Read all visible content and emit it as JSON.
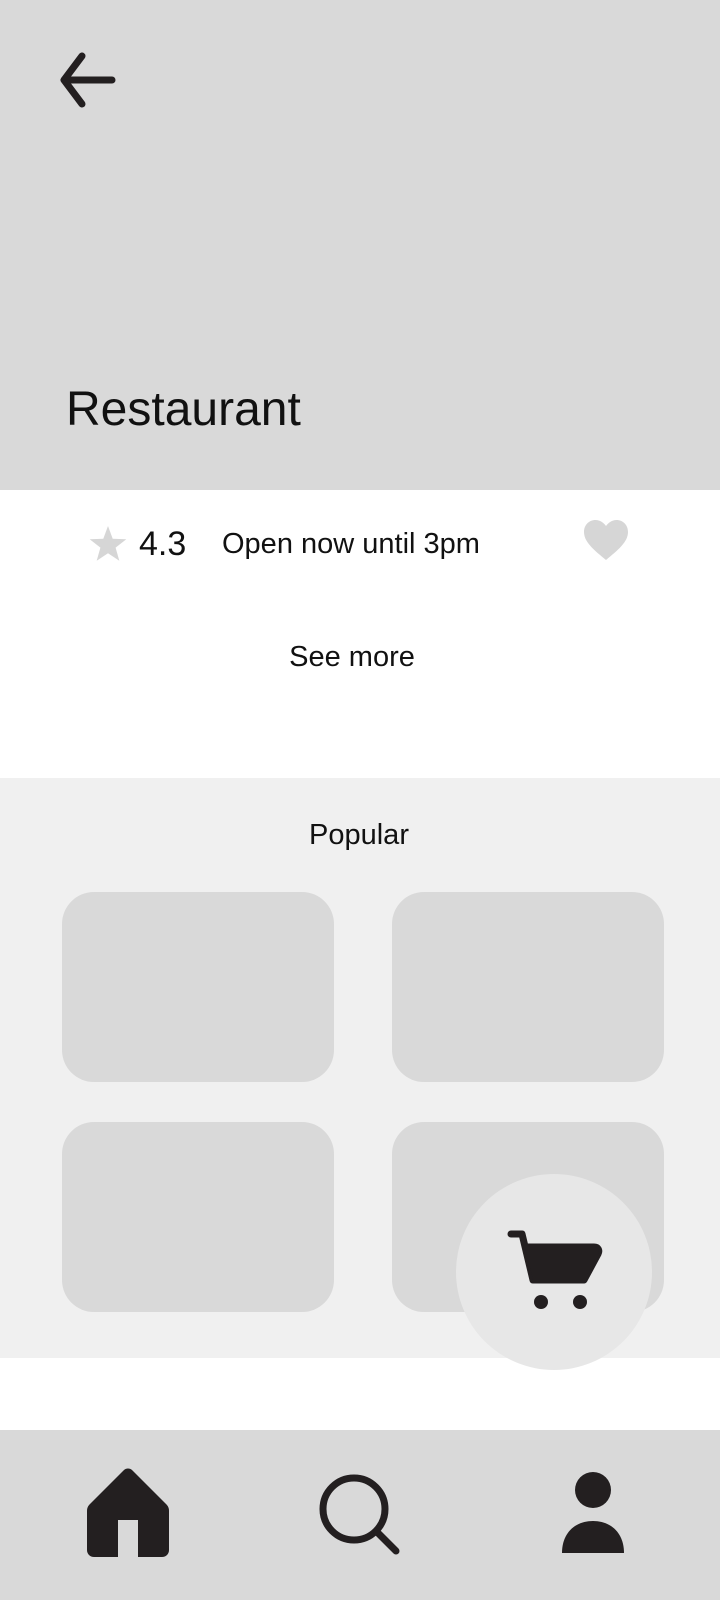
{
  "header": {
    "back_icon": "arrow-left-icon",
    "title": "Restaurant",
    "background": "#d9d9d9"
  },
  "info": {
    "rating_icon": "star-icon",
    "rating": "4.3",
    "hours": "Open now until 3pm",
    "favorite_icon": "heart-icon",
    "see_more": "See more"
  },
  "popular": {
    "title": "Popular",
    "items": [
      {
        "placeholder": true
      },
      {
        "placeholder": true
      },
      {
        "placeholder": true
      },
      {
        "placeholder": true
      }
    ]
  },
  "cart": {
    "icon": "cart-icon"
  },
  "bottom_nav": {
    "items": [
      {
        "icon": "home-icon"
      },
      {
        "icon": "search-icon"
      },
      {
        "icon": "profile-icon"
      }
    ]
  },
  "colors": {
    "placeholder": "#d9d9d9",
    "section_background": "#f0f0f0",
    "icon_dark": "#231f20",
    "icon_light": "#d6d6d6"
  }
}
